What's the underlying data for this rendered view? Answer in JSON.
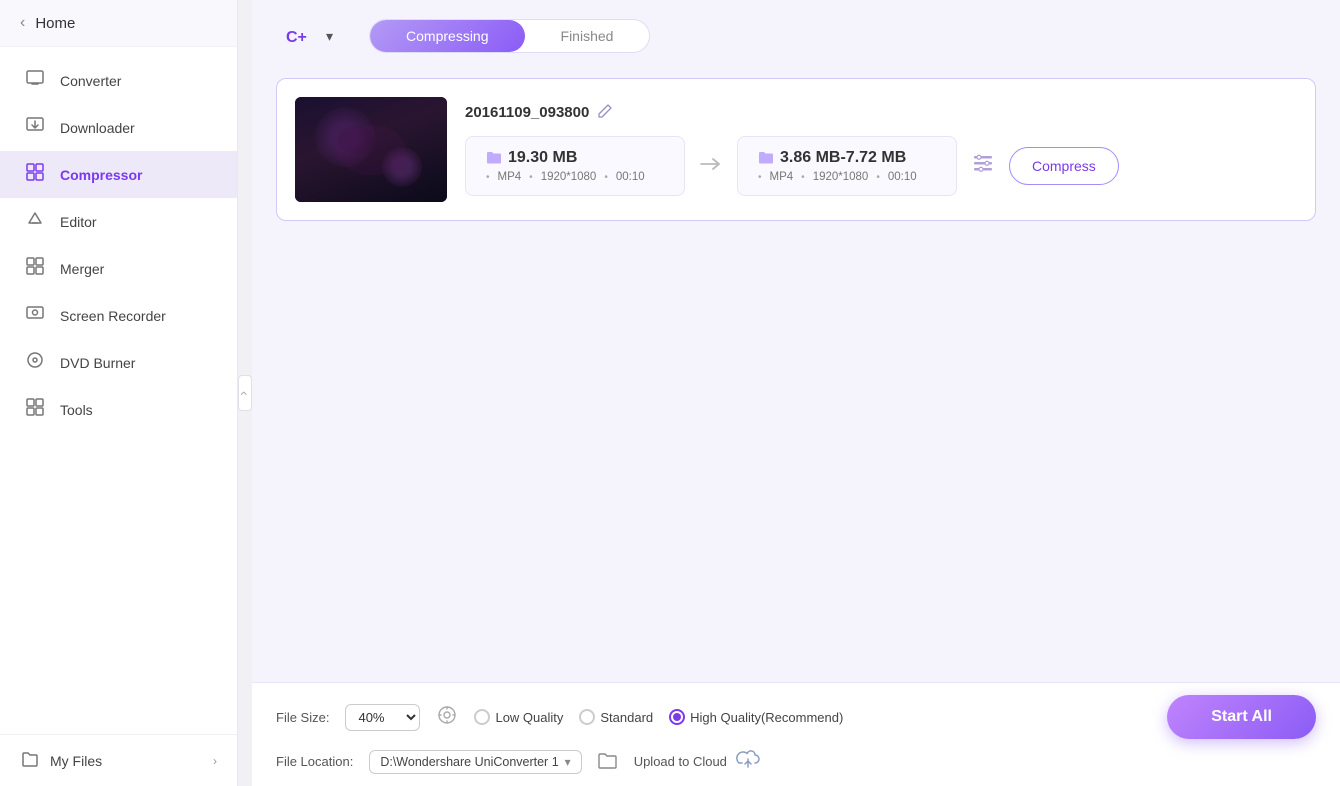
{
  "sidebar": {
    "home_label": "Home",
    "collapse_icon": "‹",
    "items": [
      {
        "id": "converter",
        "label": "Converter",
        "icon": "⊟"
      },
      {
        "id": "downloader",
        "label": "Downloader",
        "icon": "⊡"
      },
      {
        "id": "compressor",
        "label": "Compressor",
        "icon": "▣",
        "active": true
      },
      {
        "id": "editor",
        "label": "Editor",
        "icon": "✂"
      },
      {
        "id": "merger",
        "label": "Merger",
        "icon": "⊞"
      },
      {
        "id": "screen-recorder",
        "label": "Screen Recorder",
        "icon": "⊙"
      },
      {
        "id": "dvd-burner",
        "label": "DVD Burner",
        "icon": "◎"
      },
      {
        "id": "tools",
        "label": "Tools",
        "icon": "⊟"
      }
    ],
    "my_files_label": "My Files",
    "my_files_icon": "📁"
  },
  "header": {
    "logo_text": "C+",
    "logo_dropdown": "▾",
    "tabs": [
      {
        "id": "compressing",
        "label": "Compressing",
        "active": true
      },
      {
        "id": "finished",
        "label": "Finished",
        "active": false
      }
    ]
  },
  "file_card": {
    "filename": "20161109_093800",
    "edit_icon": "✎",
    "source": {
      "folder_icon": "📁",
      "size": "19.30 MB",
      "format": "MP4",
      "resolution": "1920*1080",
      "duration": "00:10"
    },
    "target": {
      "folder_icon": "📁",
      "size": "3.86 MB-7.72 MB",
      "format": "MP4",
      "resolution": "1920*1080",
      "duration": "00:10"
    },
    "settings_icon": "⚙",
    "compress_btn": "Compress"
  },
  "bottom_bar": {
    "file_size_label": "File Size:",
    "size_value": "40%",
    "quality_icon": "⚙",
    "quality_options": [
      {
        "id": "low",
        "label": "Low Quality",
        "checked": false
      },
      {
        "id": "standard",
        "label": "Standard",
        "checked": false
      },
      {
        "id": "high",
        "label": "High Quality(Recommend)",
        "checked": true
      }
    ],
    "file_location_label": "File Location:",
    "location_value": "D:\\Wondershare UniConverter 1",
    "folder_icon": "📂",
    "upload_label": "Upload to Cloud",
    "cloud_icon": "☁",
    "start_all_btn": "Start All"
  }
}
